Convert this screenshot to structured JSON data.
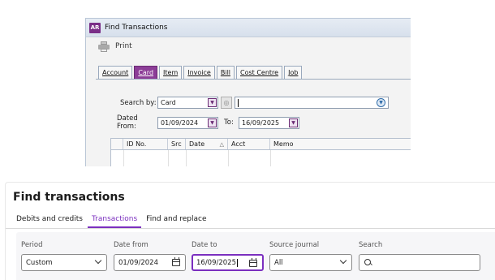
{
  "classic": {
    "logo": "AR",
    "title": "Find Transactions",
    "print_label": "Print",
    "tabs": [
      "Account",
      "Card",
      "Item",
      "Invoice",
      "Bill",
      "Cost Centre",
      "Job"
    ],
    "search_by_label": "Search by:",
    "search_by_value": "Card",
    "dated_from_label": "Dated From:",
    "dated_from_value": "01/09/2024",
    "to_label": "To:",
    "to_value": "16/09/2025",
    "columns": [
      "ID No.",
      "Src",
      "Date",
      "Acct",
      "Memo"
    ],
    "sort_glyph": "△"
  },
  "modern": {
    "title": "Find transactions",
    "tabs": [
      "Debits and credits",
      "Transactions",
      "Find and replace"
    ],
    "active_tab": "Transactions",
    "period_label": "Period",
    "period_value": "Custom",
    "date_from_label": "Date from",
    "date_from_value": "01/09/2024",
    "date_to_label": "Date to",
    "date_to_value": "16/09/2025",
    "source_label": "Source journal",
    "source_value": "All",
    "search_label": "Search"
  },
  "colors": {
    "accent": "#7b2fbf",
    "classic_accent": "#8c3d97"
  }
}
